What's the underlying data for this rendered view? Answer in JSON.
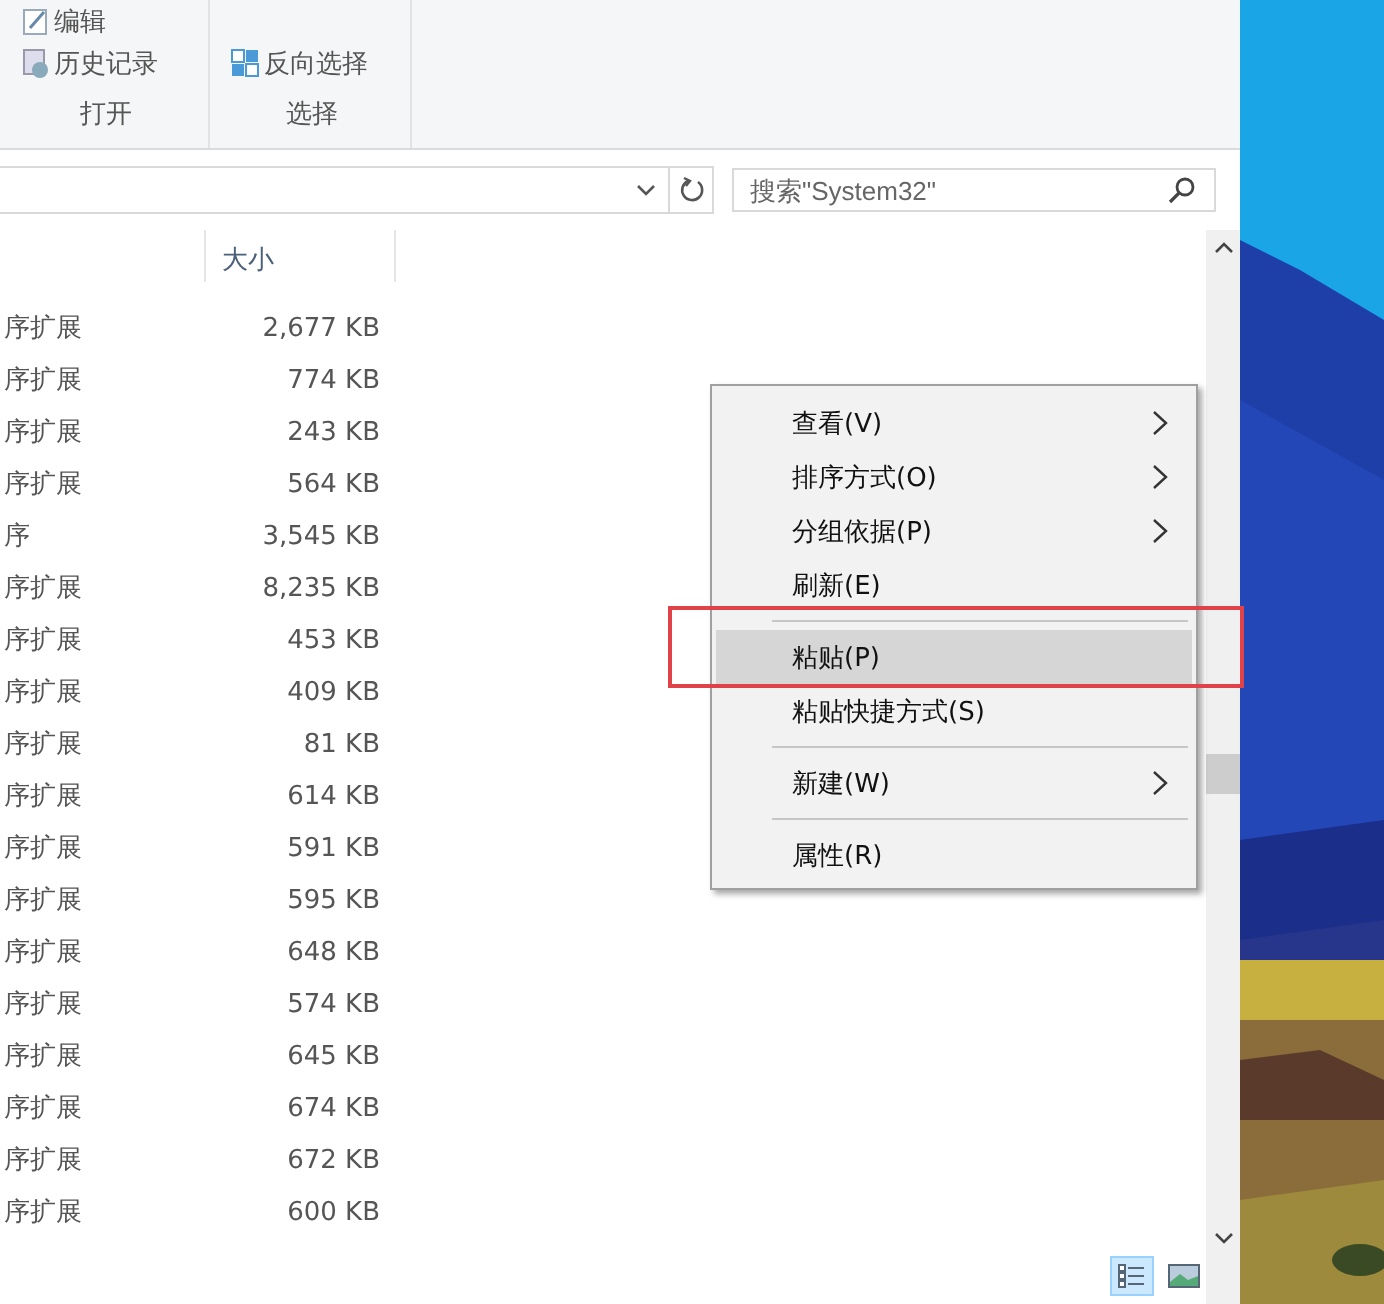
{
  "ribbon": {
    "groups": [
      {
        "label": "打开",
        "items": [
          {
            "label": "编辑"
          },
          {
            "label": "历史记录"
          }
        ]
      },
      {
        "label": "选择",
        "items": [
          {
            "label": "反向选择"
          }
        ]
      }
    ]
  },
  "search": {
    "placeholder": "搜索\"System32\""
  },
  "file_list": {
    "columns": [
      {
        "label": "大小"
      }
    ],
    "rows": [
      {
        "type": "序扩展",
        "size": "2,677 KB"
      },
      {
        "type": "序扩展",
        "size": "774 KB"
      },
      {
        "type": "序扩展",
        "size": "243 KB"
      },
      {
        "type": "序扩展",
        "size": "564 KB"
      },
      {
        "type": "序",
        "size": "3,545 KB"
      },
      {
        "type": "序扩展",
        "size": "8,235 KB"
      },
      {
        "type": "序扩展",
        "size": "453 KB"
      },
      {
        "type": "序扩展",
        "size": "409 KB"
      },
      {
        "type": "序扩展",
        "size": "81 KB"
      },
      {
        "type": "序扩展",
        "size": "614 KB"
      },
      {
        "type": "序扩展",
        "size": "591 KB"
      },
      {
        "type": "序扩展",
        "size": "595 KB"
      },
      {
        "type": "序扩展",
        "size": "648 KB"
      },
      {
        "type": "序扩展",
        "size": "574 KB"
      },
      {
        "type": "序扩展",
        "size": "645 KB"
      },
      {
        "type": "序扩展",
        "size": "674 KB"
      },
      {
        "type": "序扩展",
        "size": "672 KB"
      },
      {
        "type": "序扩展",
        "size": "600 KB"
      }
    ]
  },
  "context_menu": {
    "items": [
      {
        "kind": "item",
        "label": "查看(V)",
        "submenu": true,
        "selected": false
      },
      {
        "kind": "item",
        "label": "排序方式(O)",
        "submenu": true,
        "selected": false
      },
      {
        "kind": "item",
        "label": "分组依据(P)",
        "submenu": true,
        "selected": false
      },
      {
        "kind": "item",
        "label": "刷新(E)",
        "submenu": false,
        "selected": false
      },
      {
        "kind": "separator"
      },
      {
        "kind": "item",
        "label": "粘贴(P)",
        "submenu": false,
        "selected": true
      },
      {
        "kind": "item",
        "label": "粘贴快捷方式(S)",
        "submenu": false,
        "selected": false
      },
      {
        "kind": "separator"
      },
      {
        "kind": "item",
        "label": "新建(W)",
        "submenu": true,
        "selected": false
      },
      {
        "kind": "separator"
      },
      {
        "kind": "item",
        "label": "属性(R)",
        "submenu": false,
        "selected": false
      }
    ]
  },
  "view_buttons": [
    {
      "selected": true
    },
    {
      "selected": false
    }
  ]
}
